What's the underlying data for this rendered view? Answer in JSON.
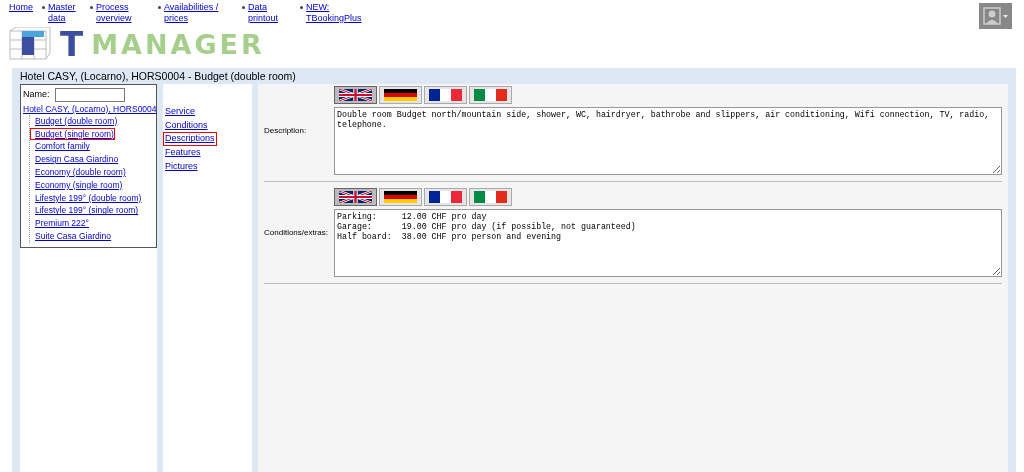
{
  "top_nav": [
    {
      "label": "Home",
      "bullet": false
    },
    {
      "label": "Master data",
      "bullet": true
    },
    {
      "label": "Process overview",
      "bullet": true
    },
    {
      "label": "Availabilities / prices",
      "bullet": true
    },
    {
      "label": "Data printout",
      "bullet": true
    },
    {
      "label": "NEW: TBookingPlus",
      "bullet": true
    }
  ],
  "logo": {
    "text": "MANAGER",
    "letter": "T"
  },
  "page_title": "Hotel CASY, (Locarno), HORS0004 - Budget (double room)",
  "tree": {
    "name_label": "Name:",
    "root": "Hotel CASY, (Locarno), HORS0004",
    "children": [
      {
        "label": "Budget (double room)",
        "selected": false
      },
      {
        "label": "Budget (single room)",
        "selected": true
      },
      {
        "label": "Comfort family",
        "selected": false
      },
      {
        "label": "Design Casa Giardino",
        "selected": false
      },
      {
        "label": "Economy (double room)",
        "selected": false
      },
      {
        "label": "Economy (single room)",
        "selected": false
      },
      {
        "label": "Lifestyle 199° (double room)",
        "selected": false
      },
      {
        "label": "Lifestyle 199° (single room)",
        "selected": false
      },
      {
        "label": "Premium 222°",
        "selected": false
      },
      {
        "label": "Suite Casa Giardino",
        "selected": false
      }
    ]
  },
  "sections": [
    {
      "label": "Service",
      "selected": false
    },
    {
      "label": "Conditions",
      "selected": false
    },
    {
      "label": "Descriptions",
      "selected": true
    },
    {
      "label": "Features",
      "selected": false
    },
    {
      "label": "Pictures",
      "selected": false
    }
  ],
  "fields": [
    {
      "label": "Description:",
      "flags": [
        {
          "kind": "uk",
          "selected": true
        },
        {
          "kind": "de",
          "selected": false
        },
        {
          "kind": "fr",
          "selected": false
        },
        {
          "kind": "it",
          "selected": false
        }
      ],
      "value": "Double room Budget north/mountain side, shower, WC, hairdryer, bathrobe and slippers, air conditioning, Wifi connection, TV, radio, telephone."
    },
    {
      "label": "Conditions/extras:",
      "flags": [
        {
          "kind": "uk",
          "selected": true
        },
        {
          "kind": "de",
          "selected": false
        },
        {
          "kind": "fr",
          "selected": false
        },
        {
          "kind": "it",
          "selected": false
        }
      ],
      "value": "Parking:     12.00 CHF pro day\nGarage:      19.00 CHF pro day (if possible, not guaranteed)\nHalf board:  38.00 CHF pro person and evening"
    }
  ]
}
